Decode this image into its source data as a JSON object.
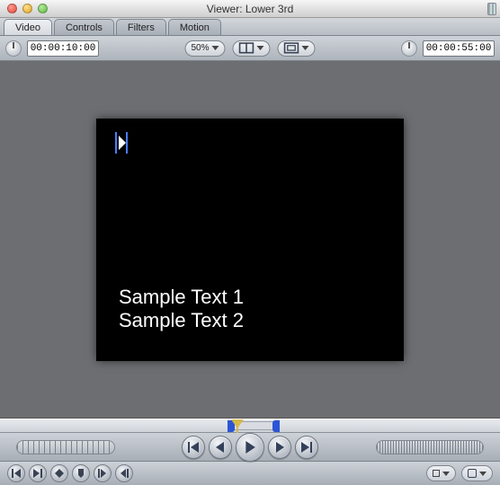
{
  "window": {
    "title": "Viewer: Lower 3rd"
  },
  "tabs": [
    {
      "label": "Video"
    },
    {
      "label": "Controls"
    },
    {
      "label": "Filters"
    },
    {
      "label": "Motion"
    }
  ],
  "active_tab_index": 0,
  "toolbar": {
    "current_tc": "00:00:10:00",
    "duration_tc": "00:00:55:00",
    "zoom_label": "50%"
  },
  "viewer": {
    "text_line_1": "Sample Text 1",
    "text_line_2": "Sample Text 2"
  },
  "colors": {
    "canvas_bg": "#6d6e72",
    "frame_bg": "#000000",
    "marker_blue": "#2b55d4",
    "playhead": "#d6b94a"
  }
}
